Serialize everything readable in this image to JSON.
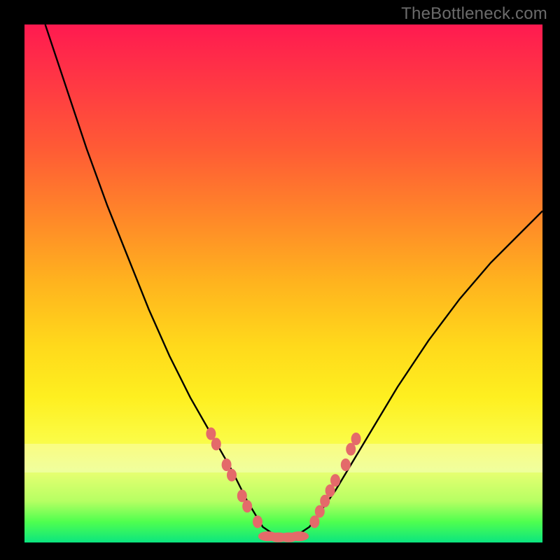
{
  "watermark": "TheBottleneck.com",
  "chart_data": {
    "type": "line",
    "title": "",
    "xlabel": "",
    "ylabel": "",
    "xlim": [
      0,
      100
    ],
    "ylim": [
      0,
      100
    ],
    "series": [
      {
        "name": "curve",
        "x": [
          4,
          8,
          12,
          16,
          20,
          24,
          28,
          32,
          36,
          40,
          43,
          46,
          49,
          52,
          55,
          60,
          66,
          72,
          78,
          84,
          90,
          96,
          100
        ],
        "values": [
          100,
          88,
          76,
          65,
          55,
          45,
          36,
          28,
          21,
          14,
          8,
          3,
          1,
          1,
          3,
          10,
          20,
          30,
          39,
          47,
          54,
          60,
          64
        ]
      }
    ],
    "markers": {
      "left_branch": [
        {
          "x": 36,
          "y": 21
        },
        {
          "x": 37,
          "y": 19
        },
        {
          "x": 39,
          "y": 15
        },
        {
          "x": 40,
          "y": 13
        },
        {
          "x": 42,
          "y": 9
        },
        {
          "x": 43,
          "y": 7
        },
        {
          "x": 45,
          "y": 4
        }
      ],
      "flat_bottom": [
        {
          "x": 47,
          "y": 1.2
        },
        {
          "x": 49,
          "y": 1
        },
        {
          "x": 51,
          "y": 1
        },
        {
          "x": 53,
          "y": 1.2
        }
      ],
      "right_branch": [
        {
          "x": 56,
          "y": 4
        },
        {
          "x": 57,
          "y": 6
        },
        {
          "x": 58,
          "y": 8
        },
        {
          "x": 59,
          "y": 10
        },
        {
          "x": 60,
          "y": 12
        },
        {
          "x": 62,
          "y": 15
        },
        {
          "x": 63,
          "y": 18
        },
        {
          "x": 64,
          "y": 20
        }
      ]
    },
    "marker_color": "#e46a6a",
    "curve_color": "#000000",
    "gradient_stops": [
      {
        "pos": 0,
        "color": "#ff1a50"
      },
      {
        "pos": 50,
        "color": "#ffb41e"
      },
      {
        "pos": 80,
        "color": "#fbfb44"
      },
      {
        "pos": 100,
        "color": "#0be57f"
      }
    ]
  }
}
